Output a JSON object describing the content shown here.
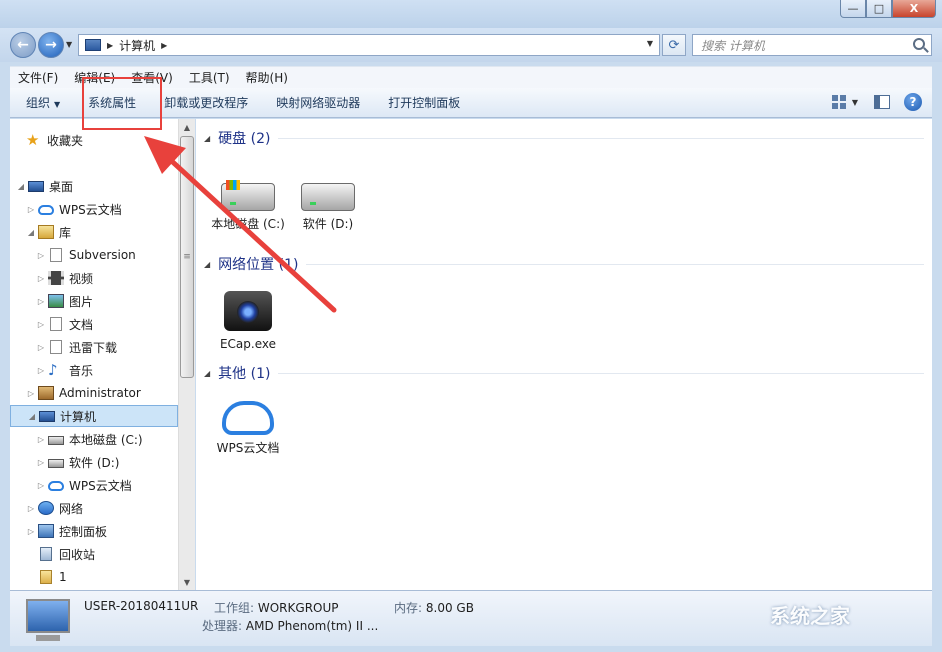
{
  "window": {
    "min_label": "—",
    "max_label": "□",
    "close_label": "X"
  },
  "address": {
    "path": "计算机",
    "search_placeholder": "搜索 计算机"
  },
  "menu": {
    "items": [
      "文件(F)",
      "编辑(E)",
      "查看(V)",
      "工具(T)",
      "帮助(H)"
    ]
  },
  "commands": {
    "organize": "组织",
    "system_properties": "系统属性",
    "uninstall": "卸载或更改程序",
    "map_drive": "映射网络驱动器",
    "control_panel": "打开控制面板"
  },
  "navpane": {
    "favorites": "收藏夹",
    "desktop": "桌面",
    "wps_cloud": "WPS云文档",
    "libraries": "库",
    "subversion": "Subversion",
    "videos": "视频",
    "pictures": "图片",
    "documents": "文档",
    "downloads": "迅雷下载",
    "music": "音乐",
    "administrator": "Administrator",
    "computer": "计算机",
    "local_c": "本地磁盘 (C:)",
    "soft_d": "软件 (D:)",
    "wps_cloud2": "WPS云文档",
    "network": "网络",
    "control_panel": "控制面板",
    "recycle_bin": "回收站",
    "folder_1": "1"
  },
  "content": {
    "hdd_group": "硬盘 (2)",
    "drive_c": "本地磁盘 (C:)",
    "drive_d": "软件 (D:)",
    "net_group": "网络位置 (1)",
    "ecap": "ECap.exe",
    "other_group": "其他 (1)",
    "wps": "WPS云文档"
  },
  "status": {
    "computer_name": "USER-20180411UR",
    "workgroup_label": "工作组:",
    "workgroup_value": "WORKGROUP",
    "memory_label": "内存:",
    "memory_value": "8.00 GB",
    "cpu_label": "处理器:",
    "cpu_value": "AMD Phenom(tm) II ..."
  },
  "watermark": "系统之家",
  "colors": {
    "accent_red": "#e8413c",
    "header_blue": "#1e3287"
  }
}
